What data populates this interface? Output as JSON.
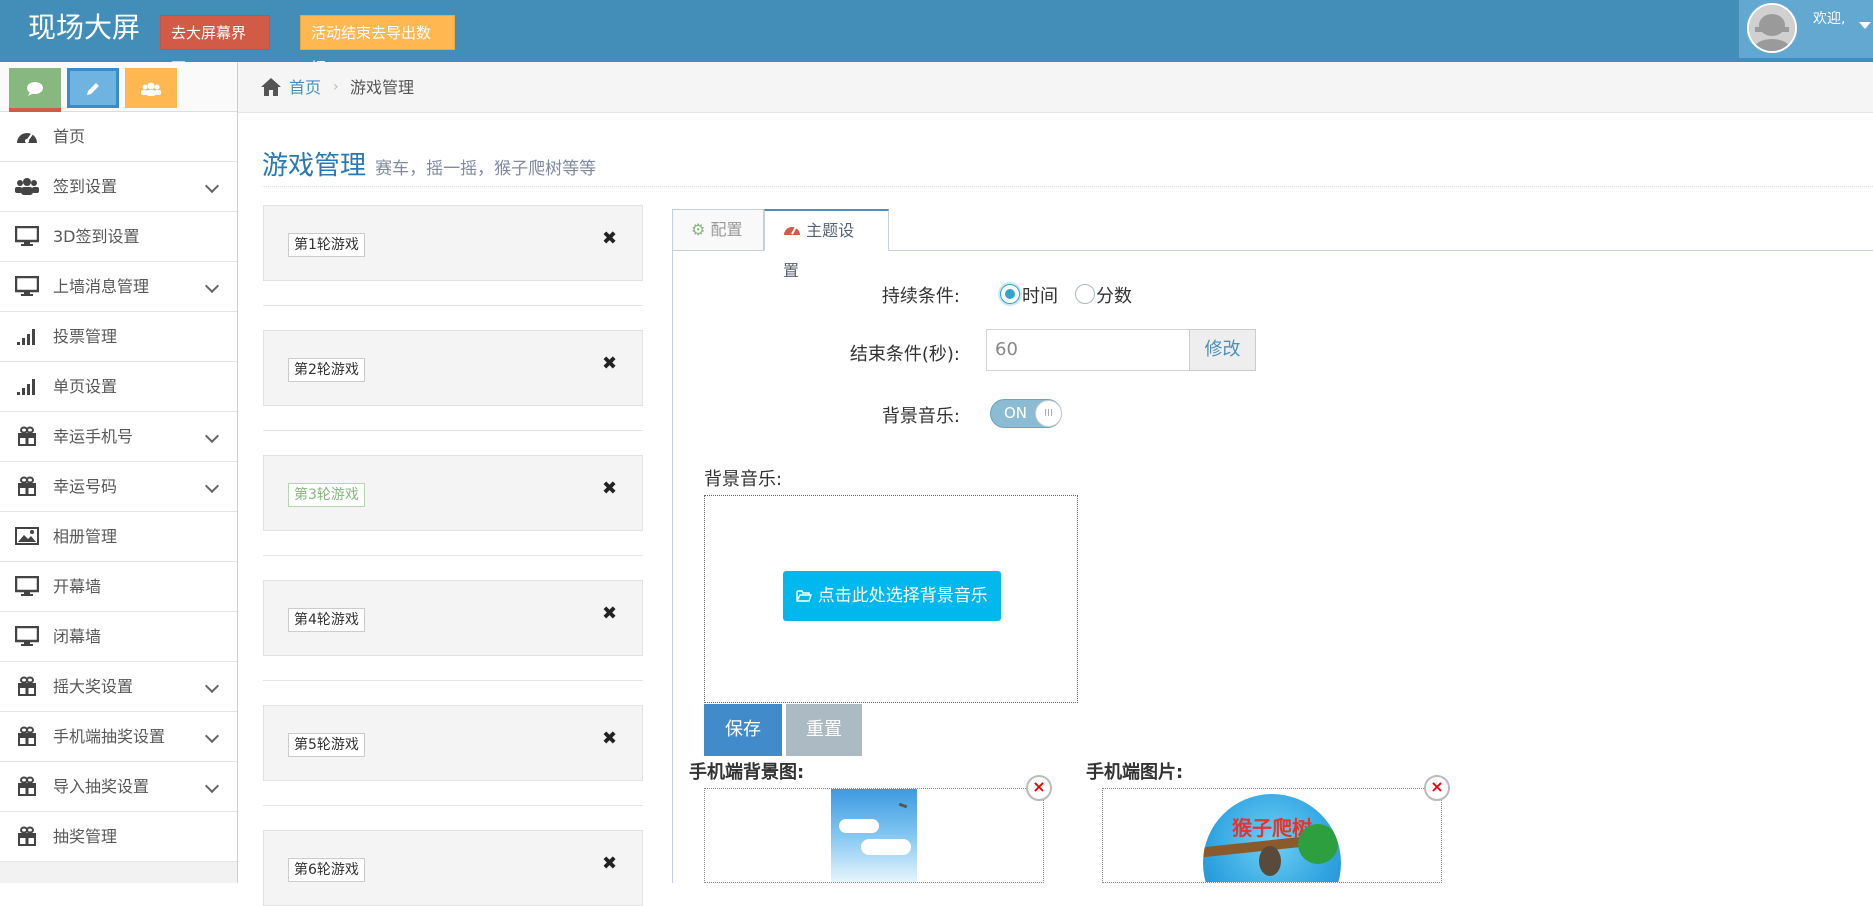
{
  "header": {
    "brand": "现场大屏",
    "btn_screen": "去大屏幕界面",
    "btn_export": "活动结束去导出数据",
    "welcome": "欢迎,"
  },
  "sidebar": {
    "shortcuts": [
      {
        "icon": "comment-icon",
        "color": "#87b87f"
      },
      {
        "icon": "pencil-icon",
        "color": "#6fb3e0"
      },
      {
        "icon": "users-icon",
        "color": "#ffb752"
      },
      {
        "icon": "cogs-icon",
        "color": "#d15b47"
      }
    ],
    "items": [
      {
        "label": "首页",
        "icon": "dashboard-icon",
        "submenu": false
      },
      {
        "label": "签到设置",
        "icon": "users-icon",
        "submenu": true
      },
      {
        "label": "3D签到设置",
        "icon": "desktop-icon",
        "submenu": false
      },
      {
        "label": "上墙消息管理",
        "icon": "desktop-icon",
        "submenu": true
      },
      {
        "label": "投票管理",
        "icon": "signal-icon",
        "submenu": false
      },
      {
        "label": "单页设置",
        "icon": "signal-icon",
        "submenu": false
      },
      {
        "label": "幸运手机号",
        "icon": "gift-icon",
        "submenu": true
      },
      {
        "label": "幸运号码",
        "icon": "gift-icon",
        "submenu": true
      },
      {
        "label": "相册管理",
        "icon": "picture-icon",
        "submenu": false
      },
      {
        "label": "开幕墙",
        "icon": "desktop-icon",
        "submenu": false
      },
      {
        "label": "闭幕墙",
        "icon": "desktop-icon",
        "submenu": false
      },
      {
        "label": "摇大奖设置",
        "icon": "gift-icon",
        "submenu": true
      },
      {
        "label": "手机端抽奖设置",
        "icon": "gift-icon",
        "submenu": true
      },
      {
        "label": "导入抽奖设置",
        "icon": "gift-icon",
        "submenu": true
      },
      {
        "label": "抽奖管理",
        "icon": "gift-icon",
        "submenu": false
      }
    ]
  },
  "breadcrumb": {
    "home": "首页",
    "current": "游戏管理"
  },
  "page": {
    "title": "游戏管理",
    "subtitle": "赛车，摇一摇，猴子爬树等等"
  },
  "rounds": [
    {
      "label": "第1轮游戏",
      "active": false
    },
    {
      "label": "第2轮游戏",
      "active": false
    },
    {
      "label": "第3轮游戏",
      "active": true
    },
    {
      "label": "第4轮游戏",
      "active": false
    },
    {
      "label": "第5轮游戏",
      "active": false
    },
    {
      "label": "第6轮游戏",
      "active": false
    }
  ],
  "tabs": [
    {
      "label": "配置",
      "active": false
    },
    {
      "label": "主题设置",
      "active": true
    }
  ],
  "form": {
    "duration_label": "持续条件:",
    "option_time": "时间",
    "option_score": "分数",
    "end_label": "结束条件(秒):",
    "end_value": "60",
    "modify_label": "修改",
    "music_label": "背景音乐:",
    "switch_on": "ON",
    "upload_title": "背景音乐:",
    "pick_music": "点击此处选择背景音乐",
    "save": "保存",
    "reset": "重置",
    "mobile_bg_title": "手机端背景图:",
    "mobile_img_title": "手机端图片:"
  }
}
